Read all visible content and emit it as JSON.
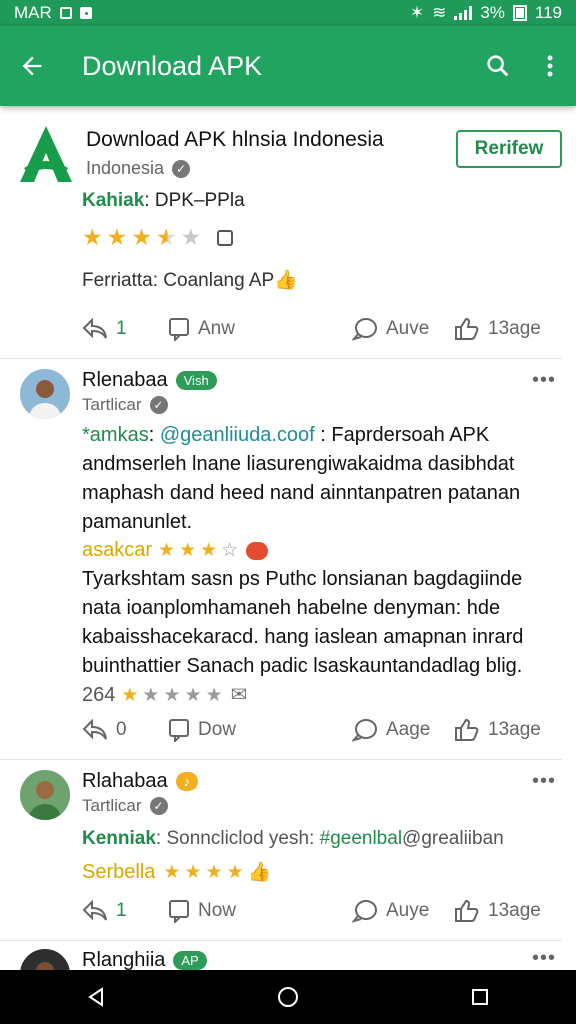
{
  "status_bar": {
    "carrier": "MAR",
    "battery_text": "3%",
    "time": "119"
  },
  "app_bar": {
    "title": "Download APK"
  },
  "app_card": {
    "name": "Download APK hlnsia Indonesia",
    "country": "Indonesia",
    "review_button": "Rerifew",
    "meta_key": "Kahiak",
    "meta_value": "DPK–PPla",
    "rating_stars": 3.5,
    "feature_text": "Ferriatta: Coanlang AP",
    "actions": {
      "reply_count": "1",
      "edit_label": "Anw",
      "comment_label": "Auve",
      "like_label": "13age"
    }
  },
  "reviews": [
    {
      "name": "Rlenabaa",
      "badge": "Vish",
      "subtitle": "Tartlicar",
      "tag_left": "*amkas",
      "mention": "@geanliiuda.coof",
      "text_after_mention": " : Faprdersoah APK andmserleh lnane liasurengiwakaidma dasibhdat maphash dand heed nand ainntanpatren patanan pamanunlet.",
      "rating_label": "asakcar",
      "rating_stars": 3.5,
      "paragraph": "Tyarkshtam sasn ps Puthc lonsianan bagdagiinde nata ioanplomhamaneh habelne denyman: hde kabaisshacekaracd. hang iaslean amapnan inrard buinthattier Sanach padic lsaskauntandadlag blig.",
      "count": "264",
      "count_stars": 1,
      "actions": {
        "reply_count": "0",
        "edit_label": "Dow",
        "comment_label": "Aage",
        "like_label": "13age"
      }
    },
    {
      "name": "Rlahabaa",
      "badge": "♪",
      "subtitle": "Tartlicar",
      "label_key": "Kenniak",
      "label_text": " Sonncliclod yesh: ",
      "label_mention": "#geenlbal",
      "label_tail": "@grealiiban",
      "rating_label": "Serbella",
      "rating_stars": 4,
      "actions": {
        "reply_count": "1",
        "edit_label": "Now",
        "comment_label": "Auye",
        "like_label": "13age"
      }
    },
    {
      "name": "Rlanghiia",
      "badge": "AP"
    }
  ],
  "colors": {
    "primary": "#22a461",
    "primary_dark": "#1f9a59",
    "accent": "#1f8b4c",
    "star": "#f0b020"
  }
}
